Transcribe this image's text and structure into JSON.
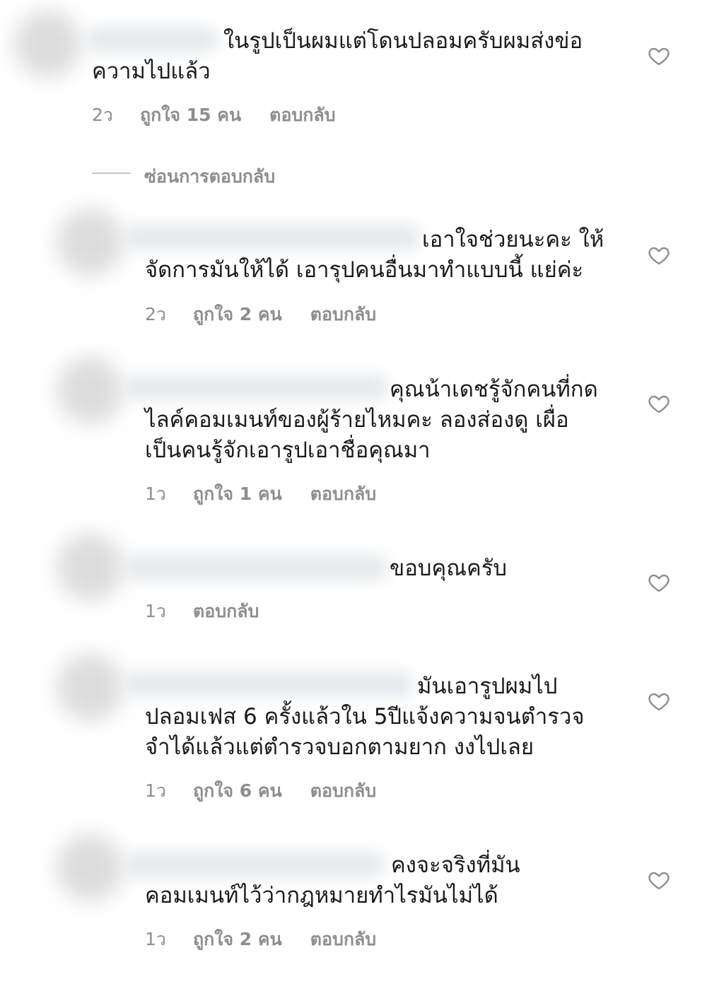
{
  "comments": [
    {
      "text": "ในรูปเป็นผมแต่โดนปลอมครับผมส่งข่อ\nความไปแล้ว",
      "time": "2ว",
      "likes": "ถูกใจ 15 คน",
      "reply": "ตอบกลับ"
    },
    {
      "text": "เอาใจช่วยนะคะ ให้\nจัดการมันให้ได้ เอารุปคนอื่นมาทำแบบนี้ แย่ค่ะ",
      "time": "2ว",
      "likes": "ถูกใจ 2 คน",
      "reply": "ตอบกลับ"
    },
    {
      "text": "คุณน้าเดชรู้จักคนที่กด\nไลค์คอมเมนท์ของผู้ร้ายไหมคะ ลองส่องดู เผื่อ\nเป็นคนรู้จักเอารูปเอาชื่อคุณมา",
      "time": "1ว",
      "likes": "ถูกใจ 1 คน",
      "reply": "ตอบกลับ"
    },
    {
      "text": "ขอบคุณครับ",
      "time": "1ว",
      "likes": "",
      "reply": "ตอบกลับ"
    },
    {
      "text": "มันเอารูปผมไป\nปลอมเฟส 6 ครั้งแล้วใน 5ปีแจ้งความจนตำรวจ\nจำได้แล้วแต่ตำรวจบอกตามยาก งงไปเลย",
      "time": "1ว",
      "likes": "ถูกใจ 6 คน",
      "reply": "ตอบกลับ"
    },
    {
      "text": "คงจะจริงที่มัน\nคอมเมนท์ไว้ว่ากฎหมายทำไรมันไม่ได้",
      "time": "1ว",
      "likes": "ถูกใจ 2 คน",
      "reply": "ตอบกลับ"
    }
  ],
  "hide_replies_label": "ซ่อนการตอบกลับ",
  "icons": {
    "like": "heart-outline-icon"
  },
  "colors": {
    "text": "#1a1a1a",
    "meta": "#8e8e8e",
    "icon": "#8e8e8e"
  }
}
